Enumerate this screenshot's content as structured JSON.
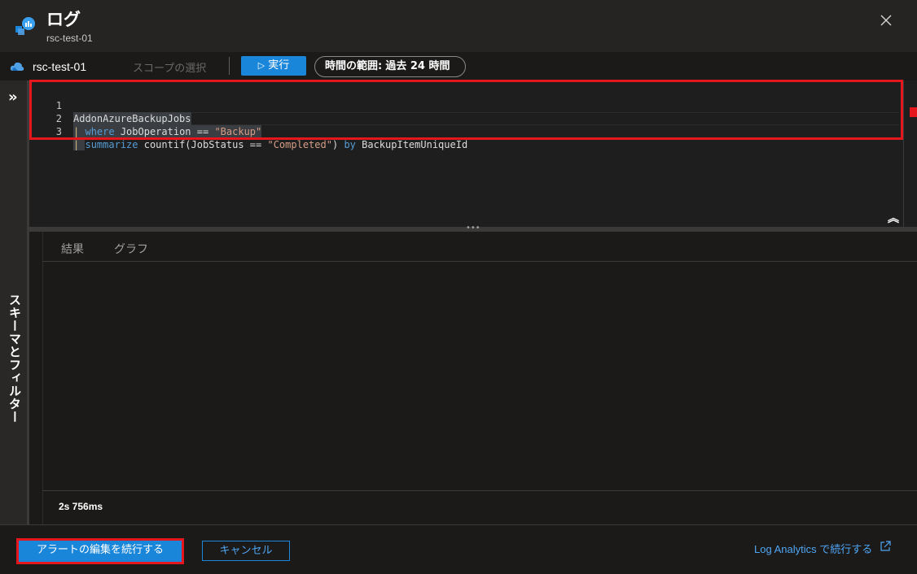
{
  "header": {
    "title": "ログ",
    "subtitle": "rsc-test-01",
    "icon": "log-analytics-icon",
    "close_icon": "close-icon"
  },
  "toolbar": {
    "workspace_name": "rsc-test-01",
    "workspace_icon": "cloud-icon",
    "scope_label": "スコープの選択",
    "run_label": "実行",
    "run_icon": "play-icon",
    "time_range_key": "時間の範囲:",
    "time_range_value": "過去 24 時間"
  },
  "left_rail": {
    "expand_icon": "double-chevron-right-icon",
    "label": "スキーマとフィルター"
  },
  "editor": {
    "line_numbers": [
      "1",
      "2",
      "3"
    ],
    "lines": [
      {
        "text": "AddonAzureBackupJobs"
      },
      {
        "pipe": "|",
        "keyword": "where",
        "field": "JobOperation",
        "op": "==",
        "value": "\"Backup\""
      },
      {
        "pipe": "|",
        "keyword": "summarize",
        "fn_open": "countif(JobStatus",
        "op": "==",
        "value": "\"Completed\"",
        "fn_close": ")",
        "by": "by",
        "group": "BackupItemUniqueId"
      }
    ],
    "collapse_icon": "double-chevron-up-icon"
  },
  "results": {
    "tabs": [
      {
        "label": "結果"
      },
      {
        "label": "グラフ"
      }
    ],
    "duration": "2s 756ms"
  },
  "footer": {
    "continue_label": "アラートの編集を続行する",
    "cancel_label": "キャンセル",
    "link_label": "Log Analytics で続行する",
    "link_icon": "external-link-icon"
  },
  "colors": {
    "accent": "#1a86d9",
    "highlight": "#e5161c",
    "link": "#4fa6f5"
  }
}
